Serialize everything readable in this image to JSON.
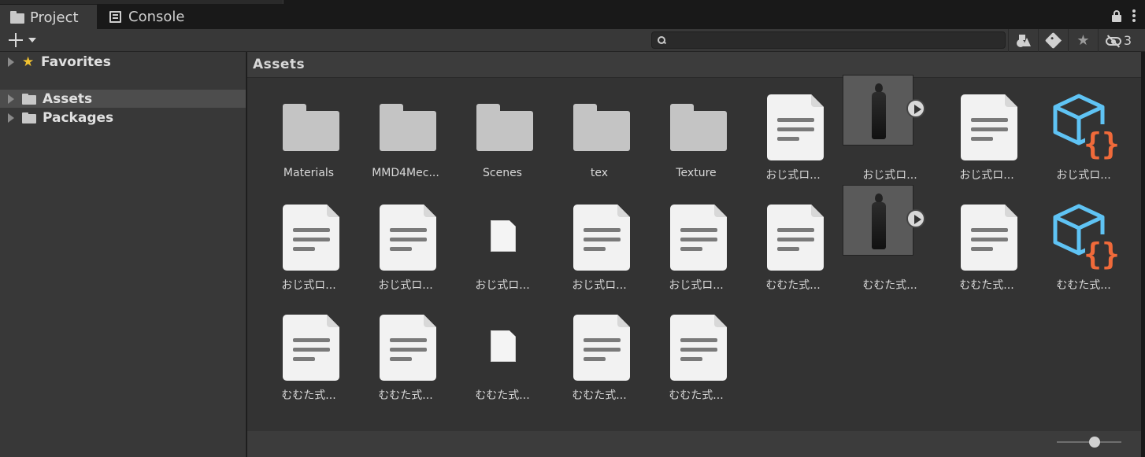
{
  "tabs": [
    {
      "label": "Project",
      "icon": "folder-icon",
      "active": true
    },
    {
      "label": "Console",
      "icon": "console-icon",
      "active": false
    }
  ],
  "toolbar": {
    "search_value": "",
    "hidden_count": "3"
  },
  "tree": [
    {
      "label": "Favorites",
      "icon": "star-icon",
      "selected": false
    },
    {
      "label": "Assets",
      "icon": "folder-icon",
      "selected": true
    },
    {
      "label": "Packages",
      "icon": "folder-icon",
      "selected": false
    }
  ],
  "main": {
    "title": "Assets",
    "items": [
      {
        "label": "Materials",
        "kind": "folder"
      },
      {
        "label": "MMD4Mec...",
        "kind": "folder"
      },
      {
        "label": "Scenes",
        "kind": "folder"
      },
      {
        "label": "tex",
        "kind": "folder"
      },
      {
        "label": "Texture",
        "kind": "folder"
      },
      {
        "label": "おじ式ロ...",
        "kind": "document"
      },
      {
        "label": "おじ式ロ...",
        "kind": "model"
      },
      {
        "label": "おじ式ロ...",
        "kind": "document"
      },
      {
        "label": "おじ式ロ...",
        "kind": "prefab"
      },
      {
        "label": "おじ式ロ...",
        "kind": "document"
      },
      {
        "label": "おじ式ロ...",
        "kind": "document"
      },
      {
        "label": "おじ式ロ...",
        "kind": "blank"
      },
      {
        "label": "おじ式ロ...",
        "kind": "document"
      },
      {
        "label": "おじ式ロ...",
        "kind": "document"
      },
      {
        "label": "むむた式...",
        "kind": "document"
      },
      {
        "label": "むむた式...",
        "kind": "model"
      },
      {
        "label": "むむた式...",
        "kind": "document"
      },
      {
        "label": "むむた式...",
        "kind": "prefab"
      },
      {
        "label": "むむた式...",
        "kind": "document"
      },
      {
        "label": "むむた式...",
        "kind": "document"
      },
      {
        "label": "むむた式...",
        "kind": "blank"
      },
      {
        "label": "むむた式...",
        "kind": "document"
      },
      {
        "label": "むむた式...",
        "kind": "document"
      }
    ]
  },
  "colors": {
    "accent_prefab": "#5fc3f4",
    "accent_script": "#f06a3a",
    "favorite_star": "#f2c230"
  }
}
